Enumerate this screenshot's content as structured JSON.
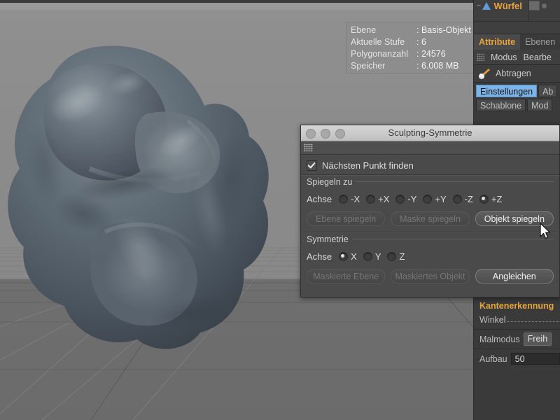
{
  "app": {
    "viewport_bg": "#8e8e8e",
    "floor_bg": "#6f6f6f",
    "accent_orange": "#e8a33d",
    "accent_blue": "#7cb3e8"
  },
  "info_overlay": {
    "rows": [
      {
        "label": "Ebene",
        "value": "Basis-Objekt"
      },
      {
        "label": "Aktuelle Stufe",
        "value": "6"
      },
      {
        "label": "Polygonanzahl",
        "value": "24576"
      },
      {
        "label": "Speicher",
        "value": "6.008 MB"
      }
    ]
  },
  "object_manager": {
    "object_name": "Würfel",
    "expander": "−"
  },
  "right_dock": {
    "tabs": [
      {
        "label": "Attribute",
        "active": true
      },
      {
        "label": "Ebenen",
        "active": false
      }
    ],
    "menus": [
      "Modus",
      "Bearbe"
    ],
    "tool": {
      "label": "Abtragen",
      "icon": "brush-icon"
    },
    "subtabs_row1": [
      {
        "label": "Einstellungen",
        "selected": true
      },
      {
        "label": "Ab",
        "selected": false
      }
    ],
    "subtabs_row2": [
      {
        "label": "Schablone",
        "selected": false
      },
      {
        "label": "Mod",
        "selected": false
      }
    ],
    "properties": {
      "section_title": "Kantenerkennung",
      "angle_label": "Winkel",
      "paintmode_label": "Malmodus",
      "paintmode_value": "Freih",
      "buildup_label": "Aufbau",
      "buildup_value": "50"
    }
  },
  "dialog": {
    "title": "Sculpting-Symmetrie",
    "traffic_lights": [
      "close-button",
      "minimize-button",
      "zoom-button"
    ],
    "checkbox": {
      "label": "Nächsten Punkt finden",
      "checked": true
    },
    "mirror_group": {
      "title": "Spiegeln zu",
      "axis_label": "Achse",
      "options": [
        {
          "label": "-X",
          "selected": false
        },
        {
          "label": "+X",
          "selected": false
        },
        {
          "label": "-Y",
          "selected": false
        },
        {
          "label": "+Y",
          "selected": false
        },
        {
          "label": "-Z",
          "selected": false
        },
        {
          "label": "+Z",
          "selected": true
        }
      ],
      "buttons": [
        {
          "label": "Ebene spiegeln",
          "enabled": false
        },
        {
          "label": "Maske spiegeln",
          "enabled": false
        },
        {
          "label": "Objekt spiegeln",
          "enabled": true
        }
      ]
    },
    "symmetry_group": {
      "title": "Symmetrie",
      "axis_label": "Achse",
      "options": [
        {
          "label": "X",
          "selected": true
        },
        {
          "label": "Y",
          "selected": false
        },
        {
          "label": "Z",
          "selected": false
        }
      ],
      "buttons": [
        {
          "label": "Maskierte Ebene",
          "enabled": false
        },
        {
          "label": "Maskiertes Objekt",
          "enabled": false
        },
        {
          "label": "Angleichen",
          "enabled": true
        }
      ]
    }
  }
}
